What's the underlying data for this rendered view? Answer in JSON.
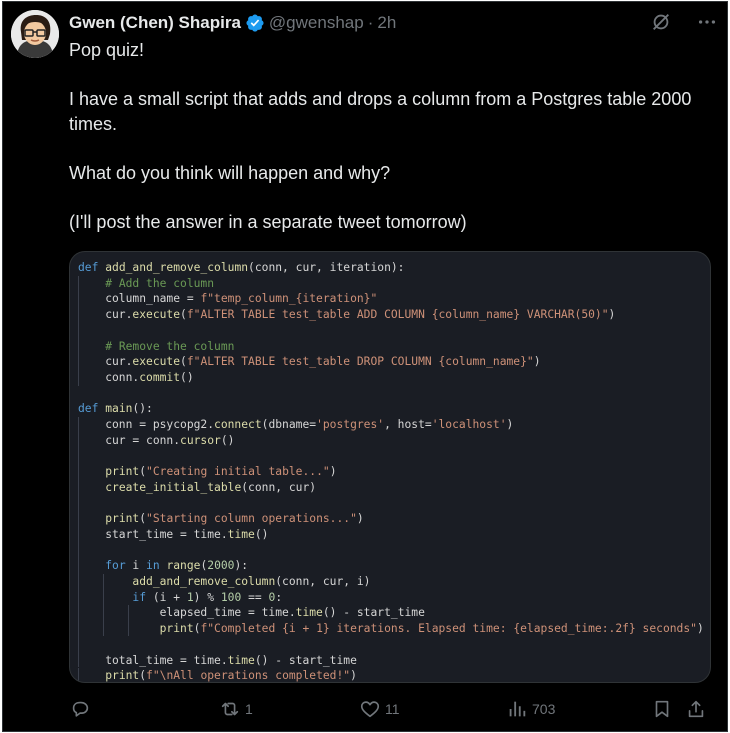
{
  "tweet": {
    "author_name": "Gwen (Chen) Shapira",
    "handle": "@gwenshap",
    "separator": "·",
    "time": "2h",
    "paragraphs": [
      "Pop quiz!",
      "I have a small script that adds and drops a column from a Postgres table 2000 times.",
      "What do you think will happen and why?",
      "(I'll post the answer in a separate tweet tomorrow)"
    ]
  },
  "code": {
    "language": "python",
    "lines": [
      "def add_and_remove_column(conn, cur, iteration):",
      "    # Add the column",
      "    column_name = f\"temp_column_{iteration}\"",
      "    cur.execute(f\"ALTER TABLE test_table ADD COLUMN {column_name} VARCHAR(50)\")",
      "",
      "    # Remove the column",
      "    cur.execute(f\"ALTER TABLE test_table DROP COLUMN {column_name}\")",
      "    conn.commit()",
      "",
      "def main():",
      "    conn = psycopg2.connect(dbname='postgres', host='localhost')",
      "    cur = conn.cursor()",
      "",
      "    print(\"Creating initial table...\")",
      "    create_initial_table(conn, cur)",
      "",
      "    print(\"Starting column operations...\")",
      "    start_time = time.time()",
      "",
      "    for i in range(2000):",
      "        add_and_remove_column(conn, cur, i)",
      "        if (i + 1) % 100 == 0:",
      "            elapsed_time = time.time() - start_time",
      "            print(f\"Completed {i + 1} iterations. Elapsed time: {elapsed_time:.2f} seconds\")",
      "",
      "    total_time = time.time() - start_time",
      "    print(f\"\\nAll operations completed!\")"
    ]
  },
  "actions": {
    "reply_count": "",
    "retweet_count": "1",
    "like_count": "11",
    "views_count": "703"
  },
  "colors": {
    "background": "#000000",
    "text": "#e7e9ea",
    "muted": "#71767b",
    "verified": "#1d9bf0",
    "code_bg": "#1a1d24"
  }
}
